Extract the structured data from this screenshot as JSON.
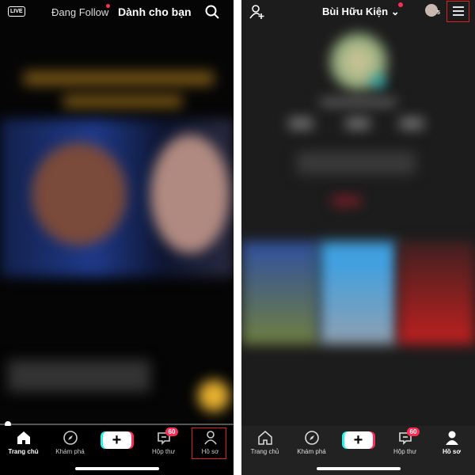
{
  "left": {
    "live_label": "LIVE",
    "tab_following": "Đang Follow",
    "tab_for_you": "Dành cho bạn",
    "nav": [
      {
        "label": "Trang chủ",
        "icon": "home-icon"
      },
      {
        "label": "Khám phá",
        "icon": "compass-icon"
      },
      {
        "label": "",
        "icon": "plus-icon"
      },
      {
        "label": "Hộp thư",
        "icon": "inbox-icon",
        "badge": "60"
      },
      {
        "label": "Hồ sơ",
        "icon": "profile-icon"
      }
    ]
  },
  "right": {
    "username": "Bùi Hữu Kiện",
    "story_count": "5",
    "nav": [
      {
        "label": "Trang chủ",
        "icon": "home-icon"
      },
      {
        "label": "Khám phá",
        "icon": "compass-icon"
      },
      {
        "label": "",
        "icon": "plus-icon"
      },
      {
        "label": "Hộp thư",
        "icon": "inbox-icon",
        "badge": "60"
      },
      {
        "label": "Hồ sơ",
        "icon": "profile-icon"
      }
    ]
  },
  "colors": {
    "accent": "#fe2c55",
    "cyan": "#25f4ee",
    "highlight": "#e02020"
  }
}
